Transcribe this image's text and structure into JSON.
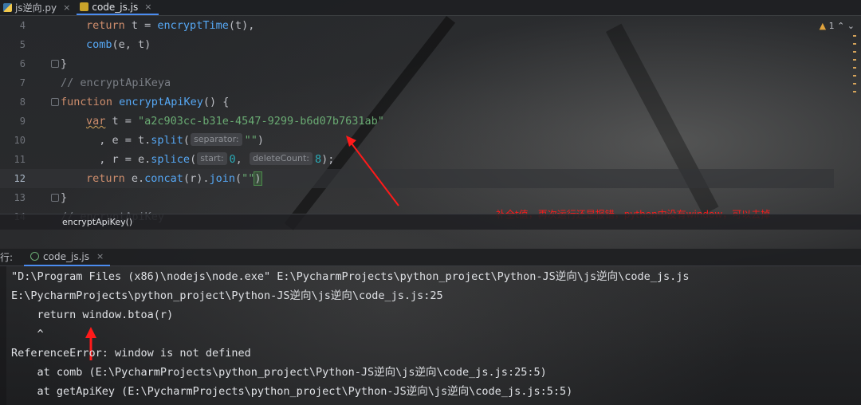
{
  "tabs": [
    {
      "label": "js逆向.py",
      "icon": "python-file-icon",
      "active": false
    },
    {
      "label": "code_js.js",
      "icon": "js-file-icon",
      "active": true
    }
  ],
  "editor": {
    "lines": [
      {
        "num": "4"
      },
      {
        "num": "5"
      },
      {
        "num": "6"
      },
      {
        "num": "7"
      },
      {
        "num": "8"
      },
      {
        "num": "9"
      },
      {
        "num": "10"
      },
      {
        "num": "11"
      },
      {
        "num": "12"
      },
      {
        "num": "13"
      },
      {
        "num": "14"
      }
    ],
    "line4": {
      "kw": "return",
      "a": " t = ",
      "fn": "encryptTime",
      "b": "(t),"
    },
    "line5": {
      "fn": "comb",
      "a": "(e, t)"
    },
    "line6": {
      "text": "}"
    },
    "line7": {
      "text": "// encryptApiKeya"
    },
    "line8": {
      "kw": "function",
      "fn": "encryptApiKey",
      "a": "() {"
    },
    "line9": {
      "kw": "var",
      "a": " t = ",
      "str": "\"a2c903cc-b31e-4547-9299-b6d07b7631ab\""
    },
    "line10": {
      "a": "  , e = t.",
      "fn": "split",
      "b": "(",
      "hint": "separator:",
      "str": "\"\"",
      "c": ")"
    },
    "line11": {
      "a": "  , r = e.",
      "fn": "splice",
      "b": "(",
      "hint1": "start:",
      "num1": "0",
      "sep": ",",
      "hint2": "deleteCount:",
      "num2": "8",
      "c": ");"
    },
    "line12": {
      "kw": "return",
      "a": " e.",
      "fn1": "concat",
      "b": "(r).",
      "fn2": "join",
      "c": "(",
      "str": "\"\"",
      "d": ")"
    },
    "line13": {
      "text": "}"
    },
    "line14": {
      "text": "// encryptApiKey"
    },
    "warning_count": "1",
    "breadcrumb": "encryptApiKey()"
  },
  "annotation": "补全t值，再次运行还是报错，python中没有window，可以去掉",
  "run": {
    "label": "行:",
    "tab_label": "code_js.js"
  },
  "console": [
    "\"D:\\Program Files (x86)\\nodejs\\node.exe\" E:\\PycharmProjects\\python_project\\Python-JS逆向\\js逆向\\code_js.js",
    "E:\\PycharmProjects\\python_project\\Python-JS逆向\\js逆向\\code_js.js:25",
    "    return window.btoa(r)",
    "    ^",
    "ReferenceError: window is not defined",
    "    at comb (E:\\PycharmProjects\\python_project\\Python-JS逆向\\js逆向\\code_js.js:25:5)",
    "    at getApiKey (E:\\PycharmProjects\\python_project\\Python-JS逆向\\js逆向\\code_js.js:5:5)"
  ],
  "colors": {
    "annotation": "#ff1a1a",
    "accent": "#4b8cf0"
  }
}
